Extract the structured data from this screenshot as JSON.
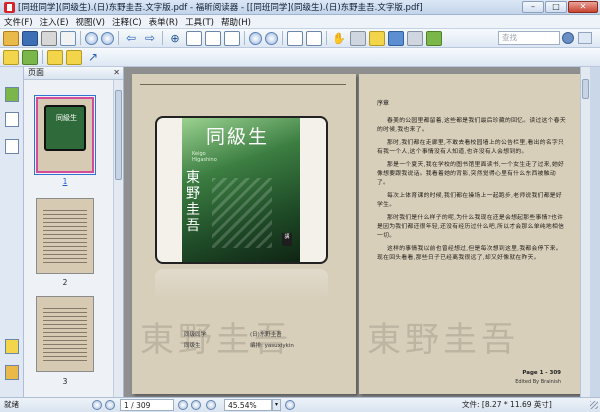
{
  "window": {
    "title": "[同班同学](同级生).(日)东野圭吾.文字版.pdf - 福昕阅读器 - [[同班同学](同级生).(日)东野圭吾.文字版.pdf]",
    "min": "–",
    "max": "□",
    "close": "✕"
  },
  "menu": [
    "文件(F)",
    "注入(E)",
    "视图(V)",
    "注释(C)",
    "表单(R)",
    "工具(T)",
    "帮助(H)"
  ],
  "toolbar": {
    "search_placeholder": "查找"
  },
  "panel": {
    "title": "页面",
    "close": "✕",
    "thumbnails": [
      {
        "number": "1",
        "selected": true
      },
      {
        "number": "2",
        "selected": false
      },
      {
        "number": "3",
        "selected": false
      }
    ]
  },
  "page1": {
    "cover_title": "同級生",
    "cover_subtitle_1": "Keigo",
    "cover_subtitle_2": "Higashino",
    "cover_author": "東野圭吾",
    "cover_publisher": "講",
    "credit_left_1": "同级同学",
    "credit_left_2": "同级生",
    "credit_right_1": "(日)东野圭吾",
    "credit_right_2": "编排: yasuxiykin",
    "watermark": "東野圭吾"
  },
  "page2": {
    "preface": "序章",
    "paragraphs": [
      "春美的公园里都留着,这些都是我们最后珍藏的回忆。读过这个春天的时候,我也来了。",
      "那时,我们都在走廊里,不敢去看校园墙上的公告栏里,看出的名字只有我一个人,这个事情没有人知道,也许没有人会想到的。",
      "那是一个夏天,我在学校的图书馆里面读书,一个女生走了过来,她好像想要跟我说话。我看着她的背影,突然觉得心里有什么东西被触动了。",
      "每次上体育课的时候,我们都在操场上一起跑步,老师说我们都是好学生。",
      "那时我们是什么样子的呢,为什么我现在还是会想起那些事情?也许是因为我们都还很年轻,还没有经历过什么吧,所以才会那么单纯地相信一切。",
      "这样的事情我以前也曾经想过,但是每次想到这里,我都会停下来。现在回头看看,那些日子已经离我很远了,却又好像就在昨天。"
    ],
    "footer_page": "Page 1 - 309",
    "footer_editor": "Edited By Brainish",
    "watermark": "東野圭吾"
  },
  "status": {
    "left": "就绪",
    "page": "1 / 309",
    "zoom": "45.54%",
    "doc_size": "文件: [8.27 * 11.69 英寸]"
  }
}
